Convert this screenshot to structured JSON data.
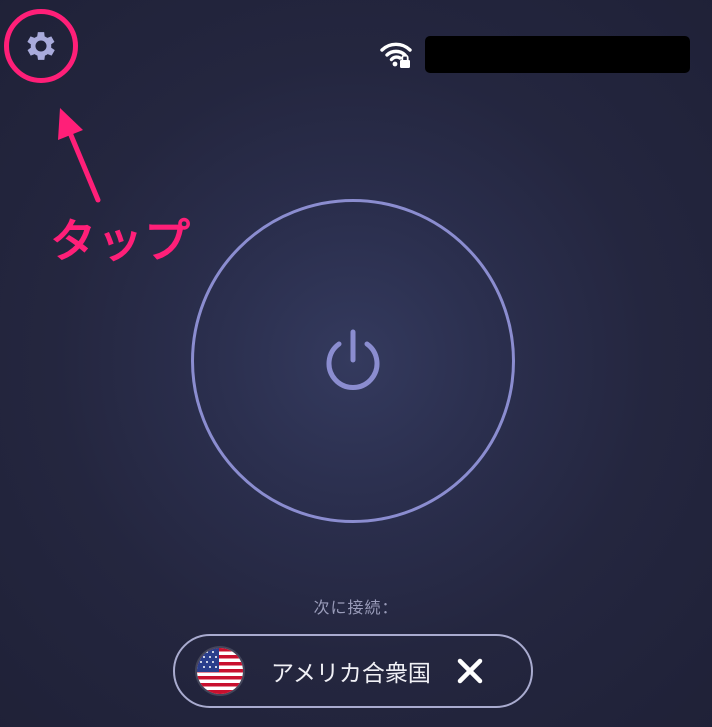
{
  "header": {
    "settings_icon": "gear-icon",
    "network_icon": "wifi-lock-icon",
    "network_name_redacted": true
  },
  "annotation": {
    "label": "タップ",
    "color": "#ff1f78",
    "arrow_icon": "arrow-up-left-icon"
  },
  "main": {
    "power_icon": "power-icon",
    "ring_color": "#8b8dd0"
  },
  "next_connection": {
    "label": "次に接続：",
    "country": "アメリカ合衆国",
    "flag_icon": "us-flag-icon",
    "clear_icon": "close-icon"
  },
  "colors": {
    "background": "#262840",
    "accent": "#8b8dd0",
    "annotation": "#ff1f78"
  }
}
